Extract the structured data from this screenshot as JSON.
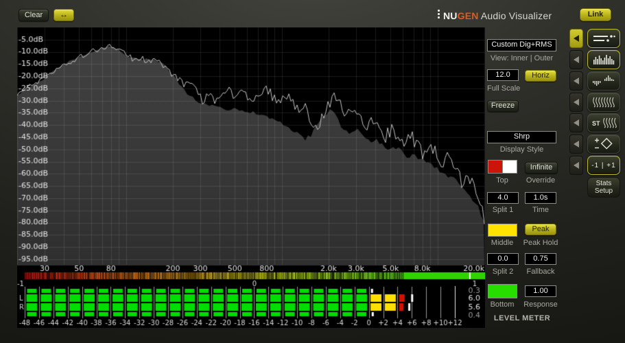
{
  "topbar": {
    "clear_label": "Clear",
    "hswap_icon": "left-right-arrows",
    "link_label": "Link",
    "brand": {
      "prefix": "NU",
      "accent": "GEN",
      "rest": " Audio Visualizer"
    }
  },
  "panel": {
    "preset": "Custom Dig+RMS",
    "view_label": "View: Inner | Outer",
    "full_scale": {
      "value": "12.0",
      "label": "Full Scale"
    },
    "horiz_label": "Horiz",
    "freeze_label": "Freeze",
    "display_style": {
      "value": "Shrp",
      "label": "Display Style"
    },
    "top": {
      "label": "Top",
      "colors": [
        "#cc1408",
        "#ffffff"
      ]
    },
    "override": {
      "label": "Override",
      "button": "Infinite"
    },
    "split1": {
      "value": "4.0",
      "label": "Split 1"
    },
    "time": {
      "value": "1.0s",
      "label": "Time"
    },
    "middle": {
      "label": "Middle",
      "color": "#ffe200"
    },
    "peak_hold": {
      "label": "Peak Hold",
      "button": "Peak"
    },
    "split2": {
      "value": "0.0",
      "label": "Split 2"
    },
    "fallback": {
      "value": "0.75",
      "label": "Fallback"
    },
    "bottom": {
      "label": "Bottom",
      "color": "#27dd00"
    },
    "response": {
      "value": "1.00",
      "label": "Response"
    },
    "section_title": "LEVEL METER"
  },
  "tools": {
    "st_label": "ST",
    "pm_label": "-1 | +1",
    "stats_line1": "Stats",
    "stats_line2": "Setup"
  },
  "chart_data": {
    "spectrum": {
      "type": "area+line",
      "freq_min": 20,
      "freq_max": 20000,
      "db_max": 0,
      "db_min": -97.3,
      "grid": true,
      "db_ticks": [
        {
          "db": -5,
          "label": "-5.0dB"
        },
        {
          "db": -10,
          "label": "-10.0dB"
        },
        {
          "db": -15,
          "label": "-15.0dB"
        },
        {
          "db": -20,
          "label": "-20.0dB"
        },
        {
          "db": -25,
          "label": "-25.0dB"
        },
        {
          "db": -30,
          "label": "-30.0dB"
        },
        {
          "db": -35,
          "label": "-35.0dB"
        },
        {
          "db": -40,
          "label": "-40.0dB"
        },
        {
          "db": -45,
          "label": "-45.0dB"
        },
        {
          "db": -50,
          "label": "-50.0dB"
        },
        {
          "db": -55,
          "label": "-55.0dB"
        },
        {
          "db": -60,
          "label": "-60.0dB"
        },
        {
          "db": -65,
          "label": "-65.0dB"
        },
        {
          "db": -70,
          "label": "-70.0dB"
        },
        {
          "db": -75,
          "label": "-75.0dB"
        },
        {
          "db": -80,
          "label": "-80.0dB"
        },
        {
          "db": -85,
          "label": "-85.0dB"
        },
        {
          "db": -90,
          "label": "-90.0dB"
        },
        {
          "db": -95,
          "label": "-95.0dB"
        }
      ],
      "freq_ticks": [
        {
          "f": 30,
          "label": "30"
        },
        {
          "f": 50,
          "label": "50"
        },
        {
          "f": 80,
          "label": "80"
        },
        {
          "f": 200,
          "label": "200"
        },
        {
          "f": 300,
          "label": "300"
        },
        {
          "f": 500,
          "label": "500"
        },
        {
          "f": 800,
          "label": "800"
        },
        {
          "f": 2000,
          "label": "2.0k"
        },
        {
          "f": 3000,
          "label": "3.0k"
        },
        {
          "f": 5000,
          "label": "5.0k"
        },
        {
          "f": 8000,
          "label": "8.0k"
        },
        {
          "f": 20000,
          "label": "20.0k"
        }
      ],
      "series": [
        {
          "name": "rms_inner",
          "style": "area",
          "color_top": "#434343",
          "color_bottom": "#2f2f2f",
          "jitter_db": 1.0,
          "points": [
            [
              20,
              -28
            ],
            [
              23,
              -25
            ],
            [
              26,
              -23
            ],
            [
              30,
              -21
            ],
            [
              34,
              -18
            ],
            [
              39,
              -15.5
            ],
            [
              44,
              -13.5
            ],
            [
              50,
              -12
            ],
            [
              57,
              -10.5
            ],
            [
              64,
              -9.3
            ],
            [
              72,
              -8.4
            ],
            [
              80,
              -7.8
            ],
            [
              88,
              -9
            ],
            [
              97,
              -11
            ],
            [
              106,
              -12.3
            ],
            [
              117,
              -13
            ],
            [
              129,
              -13.2
            ],
            [
              142,
              -13
            ],
            [
              156,
              -13.4
            ],
            [
              172,
              -15
            ],
            [
              189,
              -18
            ],
            [
              208,
              -21
            ],
            [
              229,
              -24.5
            ],
            [
              252,
              -27.5
            ],
            [
              277,
              -29.5
            ],
            [
              305,
              -31
            ],
            [
              336,
              -32
            ],
            [
              369,
              -32.5
            ],
            [
              406,
              -33
            ],
            [
              447,
              -34
            ],
            [
              492,
              -33
            ],
            [
              541,
              -34
            ],
            [
              595,
              -35.5
            ],
            [
              655,
              -34.5
            ],
            [
              721,
              -35.5
            ],
            [
              793,
              -36.5
            ],
            [
              872,
              -37.5
            ],
            [
              960,
              -38.5
            ],
            [
              1056,
              -40
            ],
            [
              1162,
              -42
            ],
            [
              1278,
              -44
            ],
            [
              1406,
              -46
            ],
            [
              1547,
              -44
            ],
            [
              1702,
              -40
            ],
            [
              1872,
              -36
            ],
            [
              2060,
              -34
            ],
            [
              2266,
              -37
            ],
            [
              2493,
              -42
            ],
            [
              2743,
              -44
            ],
            [
              3017,
              -41
            ],
            [
              3319,
              -44
            ],
            [
              3652,
              -47
            ],
            [
              4017,
              -46
            ],
            [
              4419,
              -48
            ],
            [
              4862,
              -50
            ],
            [
              5349,
              -49
            ],
            [
              5884,
              -51
            ],
            [
              6473,
              -53
            ],
            [
              7121,
              -52
            ],
            [
              7834,
              -54
            ],
            [
              8618,
              -56
            ],
            [
              9481,
              -57
            ],
            [
              10430,
              -59
            ],
            [
              11474,
              -61
            ],
            [
              12622,
              -62
            ],
            [
              13885,
              -64
            ],
            [
              15275,
              -67
            ],
            [
              16804,
              -70
            ],
            [
              18486,
              -74
            ],
            [
              20000,
              -80
            ]
          ]
        },
        {
          "name": "peak_outer",
          "style": "line",
          "color": "#c4c4c4",
          "jitter_db": 2.8,
          "points": [
            [
              20,
              -27.5
            ],
            [
              22,
              -25.5
            ],
            [
              24,
              -24
            ],
            [
              27,
              -22.5
            ],
            [
              30,
              -20.5
            ],
            [
              33,
              -19
            ],
            [
              36,
              -17.5
            ],
            [
              40,
              -15.5
            ],
            [
              44,
              -14
            ],
            [
              48,
              -12.8
            ],
            [
              53,
              -11.5
            ],
            [
              58,
              -10.3
            ],
            [
              64,
              -9.2
            ],
            [
              70,
              -8.5
            ],
            [
              77,
              -7.8
            ],
            [
              84,
              -7.5
            ],
            [
              92,
              -9.5
            ],
            [
              101,
              -11.8
            ],
            [
              111,
              -13
            ],
            [
              122,
              -12.2
            ],
            [
              134,
              -14
            ],
            [
              147,
              -13
            ],
            [
              161,
              -14.5
            ],
            [
              177,
              -16.5
            ],
            [
              194,
              -18.5
            ],
            [
              213,
              -21
            ],
            [
              234,
              -23.5
            ],
            [
              257,
              -22
            ],
            [
              282,
              -26
            ],
            [
              310,
              -30
            ],
            [
              340,
              -27
            ],
            [
              373,
              -31
            ],
            [
              410,
              -27.5
            ],
            [
              450,
              -25.5
            ],
            [
              494,
              -28.5
            ],
            [
              542,
              -25
            ],
            [
              595,
              -28
            ],
            [
              653,
              -30.5
            ],
            [
              717,
              -26.5
            ],
            [
              787,
              -24.5
            ],
            [
              864,
              -28
            ],
            [
              949,
              -31
            ],
            [
              1041,
              -27.5
            ],
            [
              1143,
              -30
            ],
            [
              1255,
              -34
            ],
            [
              1378,
              -31
            ],
            [
              1513,
              -37
            ],
            [
              1661,
              -42
            ],
            [
              1823,
              -37
            ],
            [
              2001,
              -31
            ],
            [
              2197,
              -28
            ],
            [
              2412,
              -32
            ],
            [
              2648,
              -36
            ],
            [
              2907,
              -33
            ],
            [
              3191,
              -37
            ],
            [
              3503,
              -41
            ],
            [
              3846,
              -37
            ],
            [
              4222,
              -41
            ],
            [
              4635,
              -45
            ],
            [
              5089,
              -41
            ],
            [
              5587,
              -45
            ],
            [
              6133,
              -49
            ],
            [
              6733,
              -44
            ],
            [
              7392,
              -48
            ],
            [
              8115,
              -52
            ],
            [
              8909,
              -47
            ],
            [
              9781,
              -52
            ],
            [
              10738,
              -57
            ],
            [
              11789,
              -53
            ],
            [
              12942,
              -58
            ],
            [
              14208,
              -63
            ],
            [
              15598,
              -59
            ],
            [
              17124,
              -65
            ],
            [
              18799,
              -72
            ],
            [
              20000,
              -80
            ]
          ]
        }
      ]
    },
    "correlation": {
      "type": "band-correlation-strip",
      "scale_labels": [
        "-1",
        "0",
        "1"
      ],
      "solid_from": 0.824,
      "marker_pos": 0.967,
      "solid_color": "#2fd400",
      "marker_color": "#ffffff"
    },
    "level_meter": {
      "type": "bar-meter",
      "scale_min": -48,
      "scale_max": 12,
      "tick_step": 2,
      "tick_labels": [
        "-48",
        "-46",
        "-44",
        "-42",
        "-40",
        "-38",
        "-36",
        "-34",
        "-32",
        "-30",
        "-28",
        "-26",
        "-24",
        "-22",
        "-20",
        "-18",
        "-16",
        "-14",
        "-12",
        "-10",
        "-8",
        "-6",
        "-4",
        "-2",
        "0",
        "+2",
        "+4",
        "+6",
        "+8",
        "+10",
        "+12"
      ],
      "zones": [
        {
          "up_to_db": 0,
          "color": "#00dd00"
        },
        {
          "up_to_db": 4,
          "color": "#ffdf00"
        },
        {
          "up_to_db": 12,
          "color": "#d21000"
        }
      ],
      "rows": [
        {
          "channel": "",
          "kind": "thin",
          "bar_db": 0.0,
          "peak_db": 0.3,
          "readout": "0.3"
        },
        {
          "channel": "L",
          "kind": "main",
          "bar_db": 5.0,
          "peak_db": 5.9,
          "readout": "6.0"
        },
        {
          "channel": "R",
          "kind": "main",
          "bar_db": 4.8,
          "peak_db": 5.5,
          "readout": "5.6"
        },
        {
          "channel": "",
          "kind": "thin",
          "bar_db": 0.0,
          "peak_db": 0.4,
          "readout": "0.4"
        }
      ]
    }
  }
}
